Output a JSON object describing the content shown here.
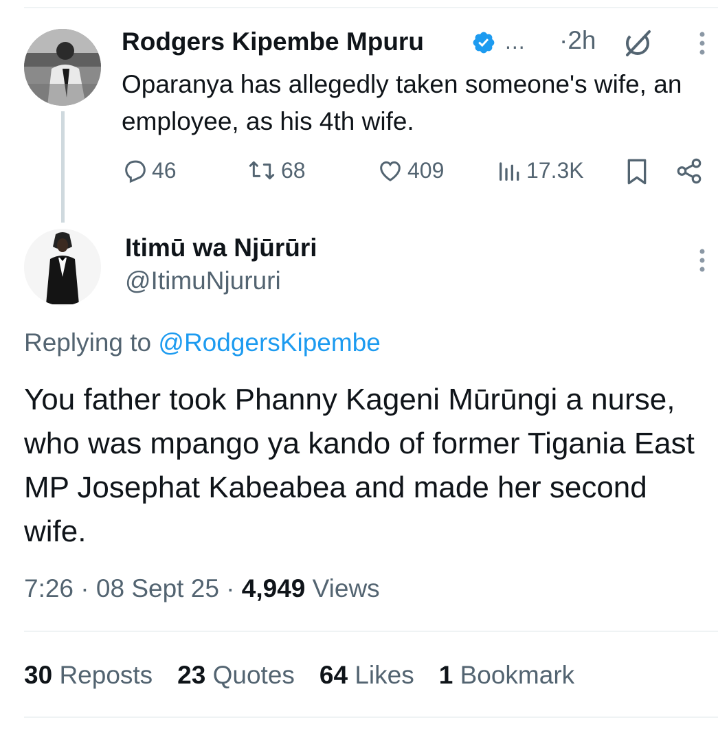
{
  "original_tweet": {
    "author_name": "Rodgers Kipembe Mpuru",
    "name_ellipsis": "...",
    "time": "·2h",
    "text": "Oparanya has allegedly taken someone's wife, an employee, as his 4th wife.",
    "replies": "46",
    "reposts": "68",
    "likes": "409",
    "views": "17.3K"
  },
  "reply_tweet": {
    "author_name": "Itimū wa Njūrūri",
    "handle": "@ItimuNjururi",
    "replying_prefix": "Replying to",
    "replying_handle": "@RodgersKipembe",
    "text": "You father took Phanny Kageni Mūrūngi a nurse, who was mpango ya kando of former Tigania East MP Josephat Kabeabea and made her second wife.",
    "time": "7:26",
    "date": "08 Sept 25",
    "views_count": "4,949",
    "views_label": "Views",
    "separator": "·"
  },
  "engagement": {
    "reposts_count": "30",
    "reposts_label": "Reposts",
    "quotes_count": "23",
    "quotes_label": "Quotes",
    "likes_count": "64",
    "likes_label": "Likes",
    "bookmarks_count": "1",
    "bookmarks_label": "Bookmark"
  },
  "icons": {
    "verified": "verified-badge-icon",
    "grok": "grok-icon",
    "more": "more-vertical-icon",
    "reply": "reply-icon",
    "repost": "repost-icon",
    "like": "heart-icon",
    "views": "views-icon",
    "bookmark": "bookmark-icon",
    "share": "share-icon"
  },
  "colors": {
    "accent": "#1d9bf0",
    "secondary_text": "#536471",
    "primary_text": "#0f1419",
    "divider": "#eff3f4"
  }
}
